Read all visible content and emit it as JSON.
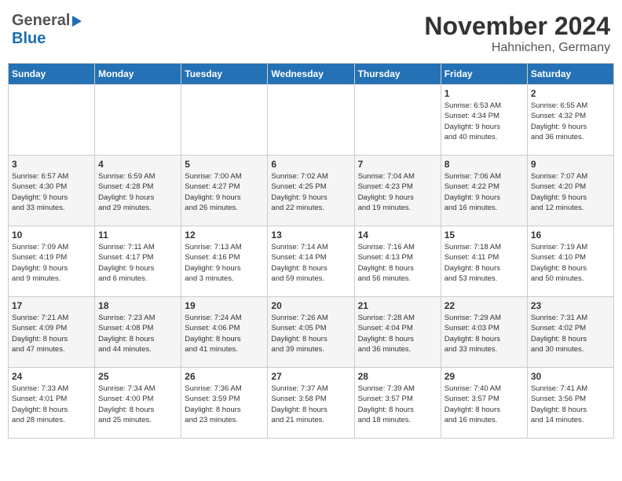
{
  "header": {
    "logo_general": "General",
    "logo_blue": "Blue",
    "month_title": "November 2024",
    "location": "Hahnichen, Germany"
  },
  "weekdays": [
    "Sunday",
    "Monday",
    "Tuesday",
    "Wednesday",
    "Thursday",
    "Friday",
    "Saturday"
  ],
  "weeks": [
    [
      {
        "day": "",
        "info": ""
      },
      {
        "day": "",
        "info": ""
      },
      {
        "day": "",
        "info": ""
      },
      {
        "day": "",
        "info": ""
      },
      {
        "day": "",
        "info": ""
      },
      {
        "day": "1",
        "info": "Sunrise: 6:53 AM\nSunset: 4:34 PM\nDaylight: 9 hours\nand 40 minutes."
      },
      {
        "day": "2",
        "info": "Sunrise: 6:55 AM\nSunset: 4:32 PM\nDaylight: 9 hours\nand 36 minutes."
      }
    ],
    [
      {
        "day": "3",
        "info": "Sunrise: 6:57 AM\nSunset: 4:30 PM\nDaylight: 9 hours\nand 33 minutes."
      },
      {
        "day": "4",
        "info": "Sunrise: 6:59 AM\nSunset: 4:28 PM\nDaylight: 9 hours\nand 29 minutes."
      },
      {
        "day": "5",
        "info": "Sunrise: 7:00 AM\nSunset: 4:27 PM\nDaylight: 9 hours\nand 26 minutes."
      },
      {
        "day": "6",
        "info": "Sunrise: 7:02 AM\nSunset: 4:25 PM\nDaylight: 9 hours\nand 22 minutes."
      },
      {
        "day": "7",
        "info": "Sunrise: 7:04 AM\nSunset: 4:23 PM\nDaylight: 9 hours\nand 19 minutes."
      },
      {
        "day": "8",
        "info": "Sunrise: 7:06 AM\nSunset: 4:22 PM\nDaylight: 9 hours\nand 16 minutes."
      },
      {
        "day": "9",
        "info": "Sunrise: 7:07 AM\nSunset: 4:20 PM\nDaylight: 9 hours\nand 12 minutes."
      }
    ],
    [
      {
        "day": "10",
        "info": "Sunrise: 7:09 AM\nSunset: 4:19 PM\nDaylight: 9 hours\nand 9 minutes."
      },
      {
        "day": "11",
        "info": "Sunrise: 7:11 AM\nSunset: 4:17 PM\nDaylight: 9 hours\nand 6 minutes."
      },
      {
        "day": "12",
        "info": "Sunrise: 7:13 AM\nSunset: 4:16 PM\nDaylight: 9 hours\nand 3 minutes."
      },
      {
        "day": "13",
        "info": "Sunrise: 7:14 AM\nSunset: 4:14 PM\nDaylight: 8 hours\nand 59 minutes."
      },
      {
        "day": "14",
        "info": "Sunrise: 7:16 AM\nSunset: 4:13 PM\nDaylight: 8 hours\nand 56 minutes."
      },
      {
        "day": "15",
        "info": "Sunrise: 7:18 AM\nSunset: 4:11 PM\nDaylight: 8 hours\nand 53 minutes."
      },
      {
        "day": "16",
        "info": "Sunrise: 7:19 AM\nSunset: 4:10 PM\nDaylight: 8 hours\nand 50 minutes."
      }
    ],
    [
      {
        "day": "17",
        "info": "Sunrise: 7:21 AM\nSunset: 4:09 PM\nDaylight: 8 hours\nand 47 minutes."
      },
      {
        "day": "18",
        "info": "Sunrise: 7:23 AM\nSunset: 4:08 PM\nDaylight: 8 hours\nand 44 minutes."
      },
      {
        "day": "19",
        "info": "Sunrise: 7:24 AM\nSunset: 4:06 PM\nDaylight: 8 hours\nand 41 minutes."
      },
      {
        "day": "20",
        "info": "Sunrise: 7:26 AM\nSunset: 4:05 PM\nDaylight: 8 hours\nand 39 minutes."
      },
      {
        "day": "21",
        "info": "Sunrise: 7:28 AM\nSunset: 4:04 PM\nDaylight: 8 hours\nand 36 minutes."
      },
      {
        "day": "22",
        "info": "Sunrise: 7:29 AM\nSunset: 4:03 PM\nDaylight: 8 hours\nand 33 minutes."
      },
      {
        "day": "23",
        "info": "Sunrise: 7:31 AM\nSunset: 4:02 PM\nDaylight: 8 hours\nand 30 minutes."
      }
    ],
    [
      {
        "day": "24",
        "info": "Sunrise: 7:33 AM\nSunset: 4:01 PM\nDaylight: 8 hours\nand 28 minutes."
      },
      {
        "day": "25",
        "info": "Sunrise: 7:34 AM\nSunset: 4:00 PM\nDaylight: 8 hours\nand 25 minutes."
      },
      {
        "day": "26",
        "info": "Sunrise: 7:36 AM\nSunset: 3:59 PM\nDaylight: 8 hours\nand 23 minutes."
      },
      {
        "day": "27",
        "info": "Sunrise: 7:37 AM\nSunset: 3:58 PM\nDaylight: 8 hours\nand 21 minutes."
      },
      {
        "day": "28",
        "info": "Sunrise: 7:39 AM\nSunset: 3:57 PM\nDaylight: 8 hours\nand 18 minutes."
      },
      {
        "day": "29",
        "info": "Sunrise: 7:40 AM\nSunset: 3:57 PM\nDaylight: 8 hours\nand 16 minutes."
      },
      {
        "day": "30",
        "info": "Sunrise: 7:41 AM\nSunset: 3:56 PM\nDaylight: 8 hours\nand 14 minutes."
      }
    ]
  ]
}
